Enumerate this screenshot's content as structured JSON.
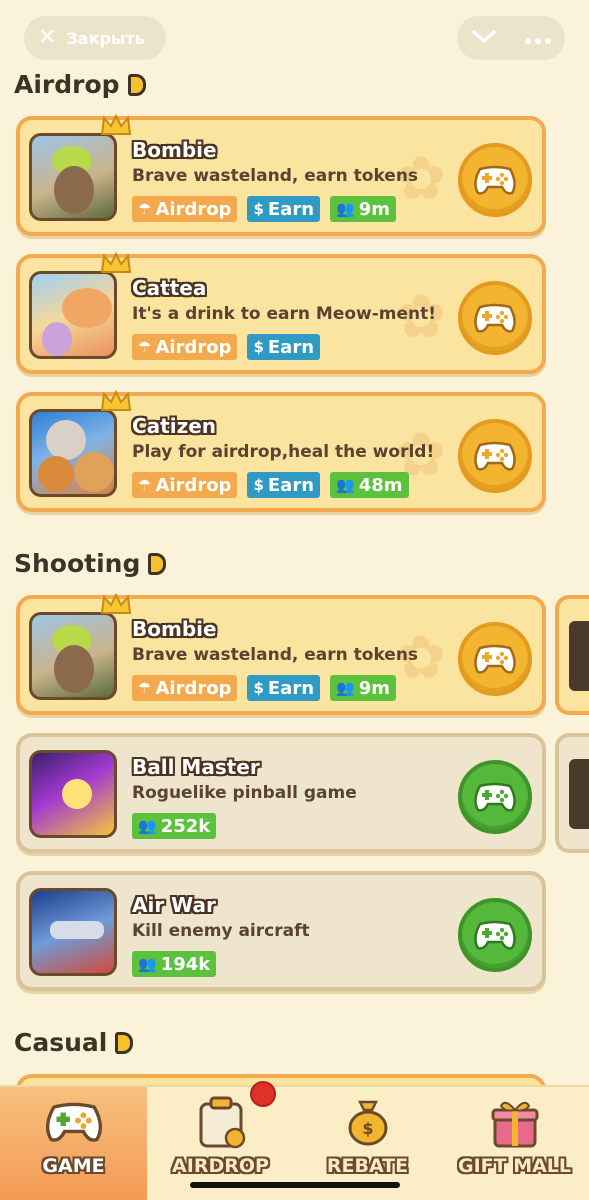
{
  "topbar": {
    "close_label": "Закрыть",
    "close_icon": "close-icon",
    "chevron_icon": "chevron-down-icon",
    "more_icon": "more-dots-icon"
  },
  "sections": [
    {
      "title": "Airdrop"
    },
    {
      "title": "Shooting"
    },
    {
      "title": "Casual"
    }
  ],
  "airdrop_cards": [
    {
      "name": "Bombie",
      "desc": "Brave wasteland, earn tokens",
      "tags": [
        "Airdrop",
        "Earn",
        "9m"
      ]
    },
    {
      "name": "Cattea",
      "desc": "It's a drink to earn Meow-ment!",
      "tags": [
        "Airdrop",
        "Earn"
      ]
    },
    {
      "name": "Catizen",
      "desc": "Play for airdrop,heal the world!",
      "tags": [
        "Airdrop",
        "Earn",
        "48m"
      ]
    }
  ],
  "shooting_cards": [
    {
      "name": "Bombie",
      "desc": "Brave wasteland, earn tokens",
      "tags": [
        "Airdrop",
        "Earn",
        "9m"
      ]
    },
    {
      "name": "Ball Master",
      "desc": "Roguelike pinball game",
      "players": "252k"
    },
    {
      "name": "Air War",
      "desc": "Kill enemy aircraft",
      "players": "194k"
    }
  ],
  "nav": [
    {
      "label": "GAME",
      "icon": "gamepad-icon",
      "active": true
    },
    {
      "label": "AIRDROP",
      "icon": "clipboard-coin-icon"
    },
    {
      "label": "REBATE",
      "icon": "money-bag-icon"
    },
    {
      "label": "GIFT MALL",
      "icon": "gift-box-icon"
    }
  ],
  "colors": {
    "background": "#fbf3d9",
    "gold_card": "#fbe3a0",
    "gold_border": "#f3a94d",
    "plain_card": "#efe4cc",
    "tag_airdrop": "#f3a94d",
    "tag_earn": "#2f9bc4",
    "tag_players": "#5cc23e",
    "play_gold": "#f3b52f",
    "play_green": "#55b83a",
    "nav_active": "#f39a54"
  }
}
